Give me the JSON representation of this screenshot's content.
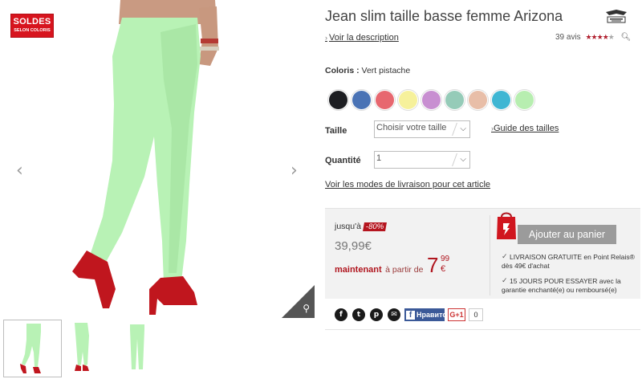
{
  "badge": {
    "line1": "SOLDES",
    "line2": "SELON COLORIS"
  },
  "gallery": {
    "prev_glyph": "‹",
    "next_glyph": "›",
    "zoom_glyph": "⚲",
    "pant_color": "#b8f2b5",
    "shoe_color": "#c0161e",
    "thumb_count": 3
  },
  "product": {
    "title": "Jean slim taille basse femme Arizona",
    "brand_logo": "arizona-logo",
    "description_link": "Voir la description",
    "reviews_count": "39 avis",
    "rating": 4,
    "rating_max": 5
  },
  "colors": {
    "label": "Coloris :",
    "selected": "Vert pistache",
    "swatches": [
      "#1d1e22",
      "#4a73b5",
      "#e7676f",
      "#f6f19b",
      "#c88fd1",
      "#95cbb8",
      "#e8bea8",
      "#3fb6d3",
      "#b7eeb0"
    ]
  },
  "size": {
    "label": "Taille",
    "placeholder": "Choisir votre taille",
    "guide_link": "Guide des tailles"
  },
  "quantity": {
    "label": "Quantité",
    "value": "1"
  },
  "delivery_link": "Voir les modes de livraison pour cet article",
  "price": {
    "upto_label": "jusqu'à",
    "discount": "-80%",
    "old_price": "39,99€",
    "now_label": "maintenant",
    "from_label": "à partir de",
    "amount_int": "7",
    "amount_cents": "99",
    "currency": "€"
  },
  "cart": {
    "button_label": "Ajouter au panier",
    "perk1_line1": "LIVRAISON GRATUITE en Point Relais®",
    "perk1_line2": "dès 49€ d'achat",
    "perk2_line1": "15 JOURS POUR ESSAYER avec la",
    "perk2_line2": "garantie enchanté(e) ou remboursé(e)"
  },
  "share": {
    "fb_like": "Нравится",
    "gplus": "G+1",
    "gplus_count": "0"
  }
}
